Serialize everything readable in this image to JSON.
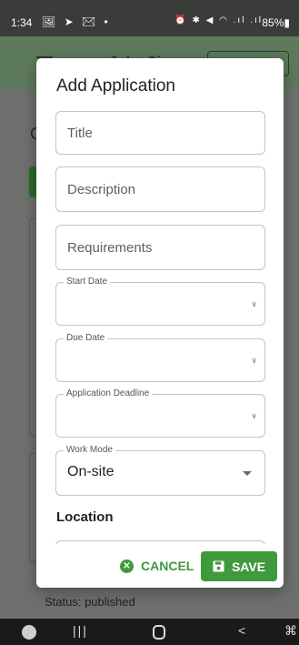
{
  "status_bar": {
    "time": "1:34",
    "left_icons": "🖼 ➤ ✉ •",
    "right_icons": "⏰ ✱ ◀ ◠ .ıl .ıl",
    "battery": "85%▮"
  },
  "background": {
    "partial_title": "Jobs Si",
    "partial_letter": "C",
    "status_text": "Status: published"
  },
  "dialog": {
    "title": "Add Application",
    "fields": {
      "title_placeholder": "Title",
      "description_placeholder": "Description",
      "requirements_placeholder": "Requirements",
      "start_date_label": "Start Date",
      "due_date_label": "Due Date",
      "deadline_label": "Application Deadline",
      "work_mode_label": "Work Mode",
      "work_mode_value": "On-site"
    },
    "location_label": "Location",
    "actions": {
      "cancel_label": "CANCEL",
      "save_label": "SAVE"
    }
  },
  "nav_bar": {
    "recents": "|||",
    "back": "<",
    "extra": "⌘"
  },
  "colors": {
    "accent": "#3f9a3c",
    "header_dimmed": "#5e7a5c"
  }
}
